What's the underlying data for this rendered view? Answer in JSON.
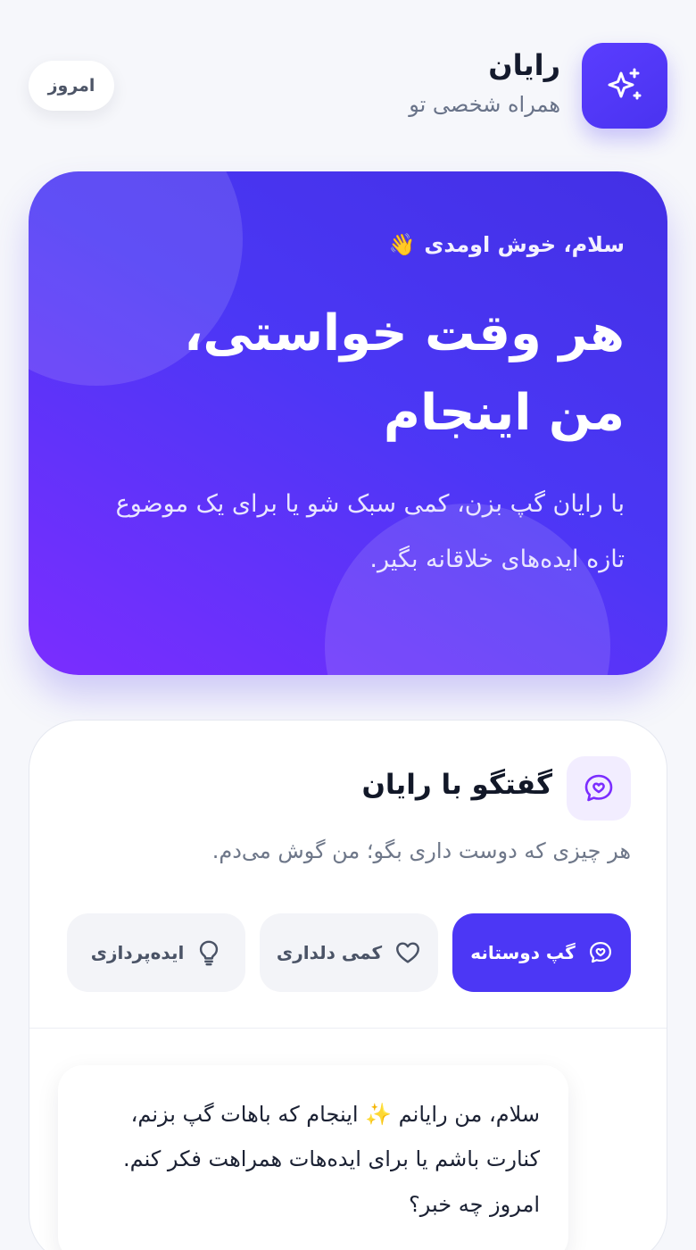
{
  "header": {
    "app_name": "رایان",
    "subtitle": "همراه شخصی تو",
    "today_label": "امروز",
    "logo_icon": "sparkles-icon"
  },
  "hero": {
    "greeting": "سلام، خوش اومدی",
    "greeting_emoji": "👋",
    "headline": "هر وقت خواستی، من اینجام",
    "description": "با رایان گپ بزن، کمی سبک شو یا برای یک موضوع تازه ایده‌های خلاقانه بگیر."
  },
  "chat": {
    "title": "گفتگو با رایان",
    "subtitle": "هر چیزی که دوست داری بگو؛ من گوش می‌دم.",
    "title_icon": "chat-heart-icon",
    "modes": [
      {
        "label": "گپ دوستانه",
        "icon": "chat-heart-icon",
        "active": true
      },
      {
        "label": "کمی دلداری",
        "icon": "heart-icon",
        "active": false
      },
      {
        "label": "ایده‌پردازی",
        "icon": "lightbulb-icon",
        "active": false
      }
    ],
    "first_message": "سلام، من رایانم ✨ اینجام که باهات گپ بزنم، کنارت باشم یا برای ایده‌هات همراهت فکر کنم. امروز چه خبر؟"
  },
  "colors": {
    "accent": "#4c37f5",
    "accent_soft": "#f2edff",
    "background": "#f6f7fb"
  }
}
